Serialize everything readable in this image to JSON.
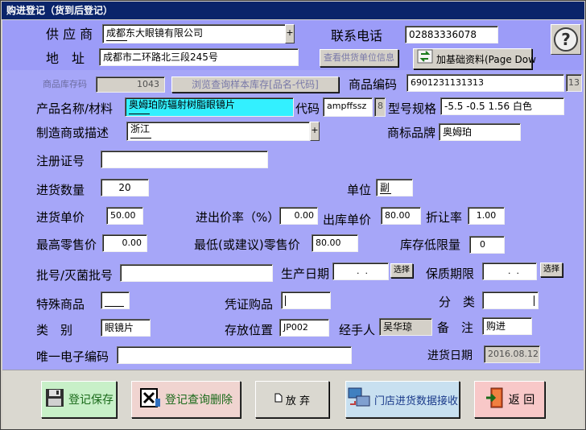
{
  "title": "购进登记（货到后登记）",
  "supplier": {
    "label": "供 应 商",
    "value": "成都东大眼镜有限公司",
    "phone_label": "联系电话",
    "phone": "02883336078",
    "address_label": "地　址",
    "address": "成都市二环路北三段245号",
    "view_supplier_btn": "查看供货单位信息",
    "add_basic_btn": "加基础资料(Page Dow"
  },
  "stock_code": {
    "label": "商品库存码",
    "value": "1043"
  },
  "browse_btn": "浏览查询样本库存[品名-代码]",
  "product_code": {
    "label": "商品编码",
    "value": "6901231131313",
    "len": "13"
  },
  "product_name": {
    "label": "产品名称/材料",
    "value": "奥姆珀防辐射树脂眼镜片"
  },
  "code": {
    "label": "代码",
    "value": "ampffssz",
    "len": "8"
  },
  "model": {
    "label": "型号规格",
    "value": "-5.5 -0.5 1.56 白色"
  },
  "maker": {
    "label": "制造商或描述",
    "value": "浙江"
  },
  "brand": {
    "label": "商标品牌",
    "value": "奥姆珀"
  },
  "reg_no": {
    "label": "注册证号",
    "value": ""
  },
  "qty": {
    "label": "进货数量",
    "value": "20"
  },
  "unit": {
    "label": "单位",
    "value": "副"
  },
  "buy_price": {
    "label": "进货单价",
    "value": "50.00"
  },
  "price_rate": {
    "label": "进出价率（%）",
    "value": "0.00"
  },
  "out_price": {
    "label": "出库单价",
    "value": "80.00"
  },
  "discount": {
    "label": "折让率",
    "value": "1.00"
  },
  "max_retail": {
    "label": "最高零售价",
    "value": "0.00"
  },
  "min_retail": {
    "label": "最低(或建议)零售价",
    "value": "80.00"
  },
  "min_stock": {
    "label": "库存低限量",
    "value": "0"
  },
  "batch": {
    "label": "批号/灭菌批号",
    "value": ""
  },
  "prod_date": {
    "label": "生产日期",
    "value": "  .  .",
    "btn": "选择"
  },
  "expiry": {
    "label": "保质期限",
    "value": "  .  .",
    "btn": "选择"
  },
  "special": {
    "label": "特殊商品",
    "value": ""
  },
  "voucher": {
    "label": "凭证购品",
    "value": ""
  },
  "category": {
    "label": "分　类",
    "value": ""
  },
  "type": {
    "label": "类　别",
    "value": "眼镜片"
  },
  "location": {
    "label": "存放位置",
    "value": "JP002"
  },
  "handler": {
    "label": "经手人",
    "value": "吴华琼"
  },
  "remark": {
    "label": "备　注",
    "value": "购进"
  },
  "ecode": {
    "label": "唯一电子编码",
    "value": ""
  },
  "buy_date": {
    "label": "进货日期",
    "value": "2016.08.12"
  },
  "buttons": {
    "save": "登记保存",
    "query_delete": "登记查询删除",
    "discard": "放 弃",
    "receive": "门店进货数据接收",
    "back": "返 回"
  },
  "colors": {
    "titlebar": "#0a246a",
    "top_panel": "#9c9cf8",
    "main_panel": "#a6a6f8",
    "highlight_field": "#33f0ff",
    "save_btn": "#c8f0c8",
    "query_btn": "#f0d4d0",
    "receive_btn": "#c8e0f0",
    "back_btn": "#f8c8c8"
  }
}
